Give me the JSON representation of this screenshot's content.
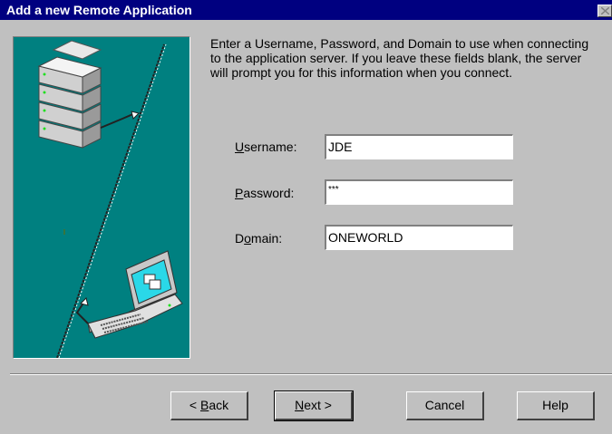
{
  "window": {
    "title": "Add a new Remote Application"
  },
  "instructions": "Enter a Username, Password, and Domain to use when connecting to the application server.  If you leave these fields blank, the server will prompt you for this information when you connect.",
  "fields": {
    "username": {
      "label_prefix": "U",
      "label_rest": "sername:",
      "value": "JDE"
    },
    "password": {
      "label_prefix": "P",
      "label_rest": "assword:",
      "value": "***"
    },
    "domain": {
      "label_pre": "D",
      "label_accel": "o",
      "label_rest": "main:",
      "value": "ONEWORLD"
    }
  },
  "buttons": {
    "back": {
      "pre": "< ",
      "accel": "B",
      "rest": "ack"
    },
    "next": {
      "accel": "N",
      "rest": "ext >"
    },
    "cancel": {
      "label": "Cancel"
    },
    "help": {
      "label": "Help"
    }
  },
  "colors": {
    "titlebar": "#000080",
    "panel": "#008080",
    "face": "#c0c0c0"
  }
}
